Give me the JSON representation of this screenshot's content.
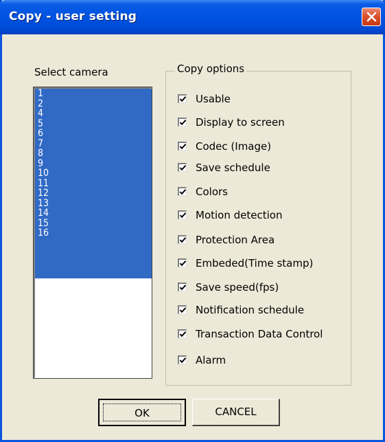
{
  "window": {
    "title": "Copy - user setting",
    "close_icon": "close-x-icon",
    "colors": {
      "titlebar": "#0053e1",
      "body": "#ece9d8",
      "close": "#d9502c",
      "selection": "#316ac5"
    }
  },
  "camera_list": {
    "label": "Select camera",
    "items": [
      "1",
      "2",
      "4",
      "5",
      "6",
      "7",
      "8",
      "9",
      "10",
      "11",
      "12",
      "13",
      "14",
      "15",
      "16"
    ],
    "all_selected": true
  },
  "copy_options": {
    "label": "Copy options",
    "options": [
      {
        "label": "Usable",
        "checked": true
      },
      {
        "label": "Display to screen",
        "checked": true
      },
      {
        "label": "Codec (Image)",
        "checked": true
      },
      {
        "label": "Save schedule",
        "checked": true
      },
      {
        "label": "Colors",
        "checked": true
      },
      {
        "label": "Motion detection",
        "checked": true
      },
      {
        "label": "Protection Area",
        "checked": true
      },
      {
        "label": "Embeded(Time stamp)",
        "checked": true
      },
      {
        "label": "Save speed(fps)",
        "checked": true
      },
      {
        "label": "Notification schedule",
        "checked": true
      },
      {
        "label": "Transaction Data Control",
        "checked": true
      },
      {
        "label": "Alarm",
        "checked": true
      }
    ]
  },
  "buttons": {
    "ok": "OK",
    "cancel": "CANCEL"
  }
}
